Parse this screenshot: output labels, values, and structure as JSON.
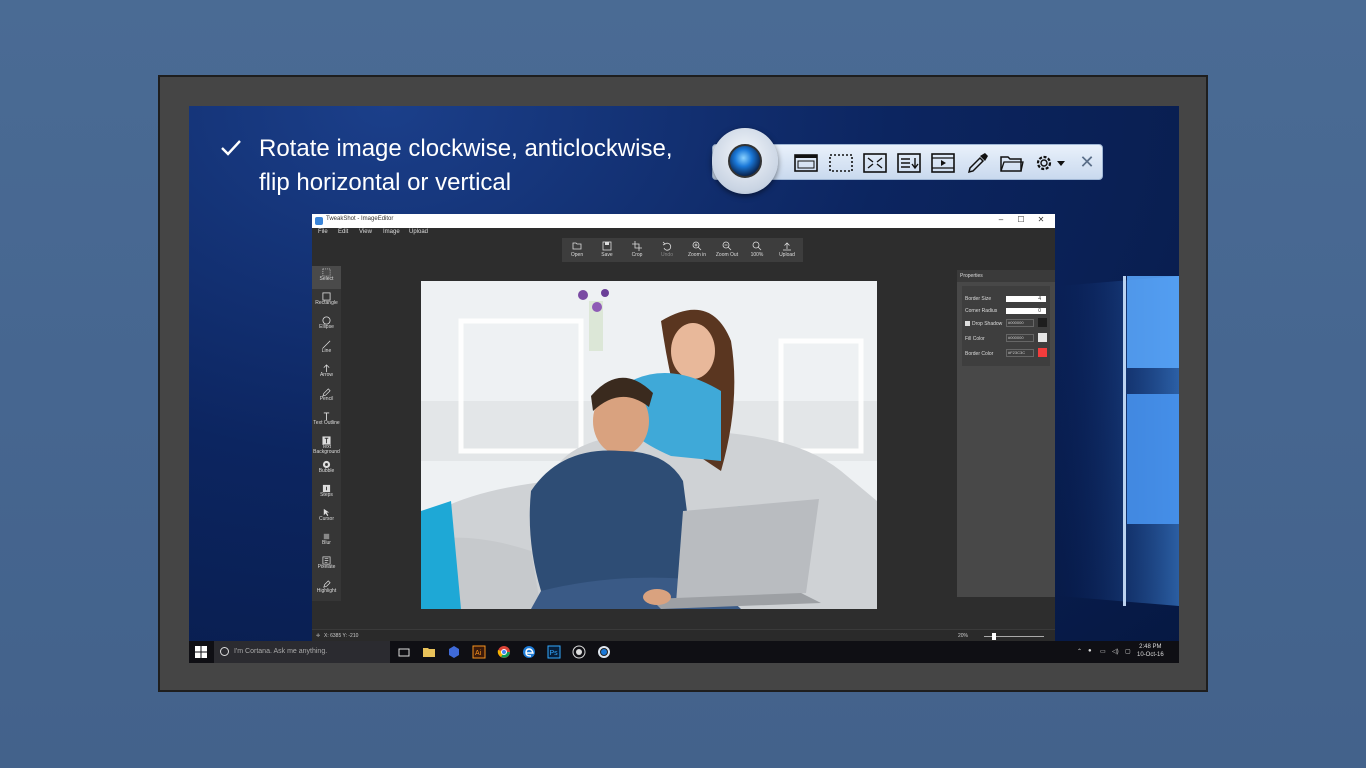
{
  "feature": {
    "line1": "Rotate image clockwise, anticlockwise,",
    "line2": "flip horizontal or vertical"
  },
  "capture_toolbar": {
    "icons": [
      "camera-lens-icon",
      "window-capture-icon",
      "region-capture-icon",
      "fullscreen-capture-icon",
      "scrolling-capture-icon",
      "video-capture-icon",
      "color-picker-icon",
      "folder-icon",
      "settings-icon",
      "close-icon"
    ],
    "close_label": "✕"
  },
  "editor": {
    "title": "TweakShot - ImageEditor",
    "window_buttons": [
      "–",
      "☐",
      "✕"
    ],
    "menu": [
      "File",
      "Edit",
      "View",
      "Image",
      "Upload"
    ],
    "toolbar": [
      {
        "label": "Open",
        "icon": "folder-open-icon"
      },
      {
        "label": "Save",
        "icon": "save-icon"
      },
      {
        "label": "Crop",
        "icon": "crop-icon"
      },
      {
        "label": "Undo",
        "icon": "undo-icon",
        "disabled": true
      },
      {
        "label": "Zoom in",
        "icon": "zoom-in-icon"
      },
      {
        "label": "Zoom Out",
        "icon": "zoom-out-icon"
      },
      {
        "label": "100%",
        "icon": "zoom-actual-icon"
      },
      {
        "label": "Upload",
        "icon": "upload-icon"
      }
    ],
    "tools": [
      {
        "label": "Select",
        "icon": "select-icon",
        "active": true
      },
      {
        "label": "Rectangle",
        "icon": "rectangle-icon"
      },
      {
        "label": "Ellipse",
        "icon": "ellipse-icon"
      },
      {
        "label": "Line",
        "icon": "line-icon"
      },
      {
        "label": "Arrow",
        "icon": "arrow-icon"
      },
      {
        "label": "Pencil",
        "icon": "pencil-icon"
      },
      {
        "label": "Text Outline",
        "icon": "text-outline-icon"
      },
      {
        "label": "Text Background",
        "icon": "text-background-icon"
      },
      {
        "label": "Bubble",
        "icon": "bubble-icon"
      },
      {
        "label": "Steps",
        "icon": "steps-icon"
      },
      {
        "label": "Cursor",
        "icon": "cursor-icon"
      },
      {
        "label": "Blur",
        "icon": "blur-icon"
      },
      {
        "label": "Pixelate",
        "icon": "pixelate-icon"
      },
      {
        "label": "Highlight",
        "icon": "highlight-icon"
      }
    ],
    "properties": {
      "header": "Properties",
      "border_size_label": "Border Size",
      "border_size_value": "4",
      "corner_radius_label": "Corner Radius",
      "corner_radius_value": "0",
      "drop_shadow_label": "Drop Shadow",
      "drop_shadow_checked": true,
      "drop_shadow_color": "#000000",
      "fill_color_label": "Fill Color",
      "fill_color_value": "#000000",
      "fill_color_swatch": "#e6e6e6",
      "border_color_label": "Border Color",
      "border_color_value": "#F23C3C",
      "border_color_swatch": "#f23c3c"
    },
    "status": {
      "coords": "X: 6385 Y: -210",
      "zoom": "20%"
    }
  },
  "taskbar": {
    "cortana_placeholder": "I'm Cortana. Ask me anything.",
    "time": "2:48 PM",
    "date": "10-Oct-16"
  }
}
